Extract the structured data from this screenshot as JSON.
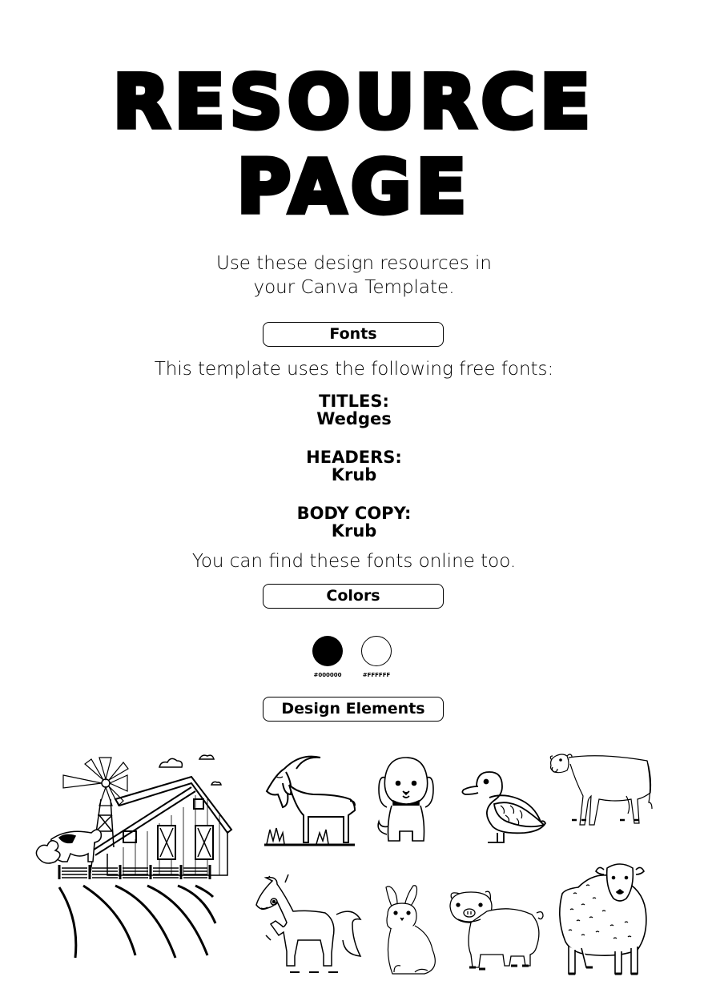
{
  "title": {
    "line1": "RESOURCE",
    "line2": "PAGE"
  },
  "intro": {
    "line1": "Use these design resources in",
    "line2": "your Canva Template."
  },
  "fonts_section": {
    "heading": "Fonts",
    "description": "This template uses the following free fonts:",
    "entries": [
      {
        "label": "TITLES:",
        "font": "Wedges"
      },
      {
        "label": "HEADERS:",
        "font": "Krub"
      },
      {
        "label": "BODY COPY:",
        "font": "Krub"
      }
    ],
    "footer": "You can find these fonts online too."
  },
  "colors_section": {
    "heading": "Colors",
    "swatches": [
      {
        "hex": "#000000",
        "label": "#000000"
      },
      {
        "hex": "#FFFFFF",
        "label": "#FFFFFF"
      }
    ]
  },
  "design_elements_section": {
    "heading": "Design Elements",
    "elements": [
      {
        "name": "farm-scene-icon"
      },
      {
        "name": "goat-icon"
      },
      {
        "name": "puppy-icon"
      },
      {
        "name": "duck-icon"
      },
      {
        "name": "cow-icon"
      },
      {
        "name": "horse-icon"
      },
      {
        "name": "rabbit-icon"
      },
      {
        "name": "pig-icon"
      },
      {
        "name": "sheep-icon"
      }
    ]
  }
}
